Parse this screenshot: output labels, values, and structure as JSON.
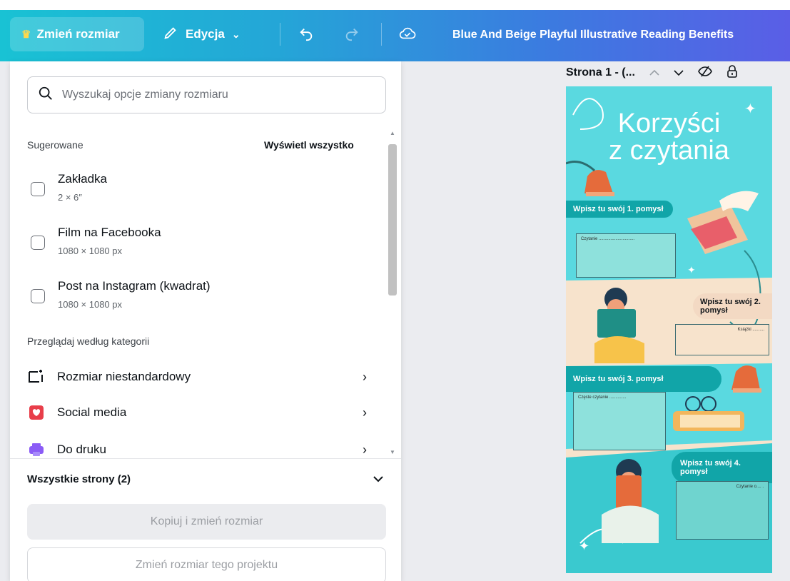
{
  "toolbar": {
    "resize_label": "Zmień rozmiar",
    "edit_label": "Edycja",
    "doc_title": "Blue And Beige Playful Illustrative Reading Benefits"
  },
  "panel": {
    "search_placeholder": "Wyszukaj opcje zmiany rozmiaru",
    "suggested_label": "Sugerowane",
    "see_all_label": "Wyświetl wszystko",
    "suggested": [
      {
        "name": "Zakładka",
        "dim": "2 × 6″"
      },
      {
        "name": "Film na Facebooka",
        "dim": "1080 × 1080 px"
      },
      {
        "name": "Post na Instagram (kwadrat)",
        "dim": "1080 × 1080 px"
      }
    ],
    "browse_label": "Przeglądaj według kategorii",
    "categories": [
      {
        "label": "Rozmiar niestandardowy",
        "icon": "custom-size-icon"
      },
      {
        "label": "Social media",
        "icon": "heart-icon",
        "color": "#e83e4a"
      },
      {
        "label": "Do druku",
        "icon": "printer-icon",
        "color": "#8b5cf6"
      }
    ],
    "pages_label": "Wszystkie strony (2)",
    "copy_resize_label": "Kopiuj i zmień rozmiar",
    "resize_project_label": "Zmień rozmiar tego projektu"
  },
  "page_header": {
    "title": "Strona 1 - (..."
  },
  "design": {
    "title_line1": "Korzyści",
    "title_line2": "z czytania",
    "idea1": "Wpisz tu swój 1. pomysł",
    "box1": "Czytanie ..............................",
    "idea2": "Wpisz tu swój 2. pomysł",
    "box2": "Książki ..........",
    "idea3": "Wpisz tu swój 3. pomysł",
    "box3": "Częste czytanie ..............",
    "idea4": "Wpisz tu swój 4. pomysł",
    "box4": "Czytanie o.... ."
  },
  "colors": {
    "accent": "#24a6d7",
    "design_bg": "#5ad9e0",
    "beige_band": "#f7e3cc"
  }
}
